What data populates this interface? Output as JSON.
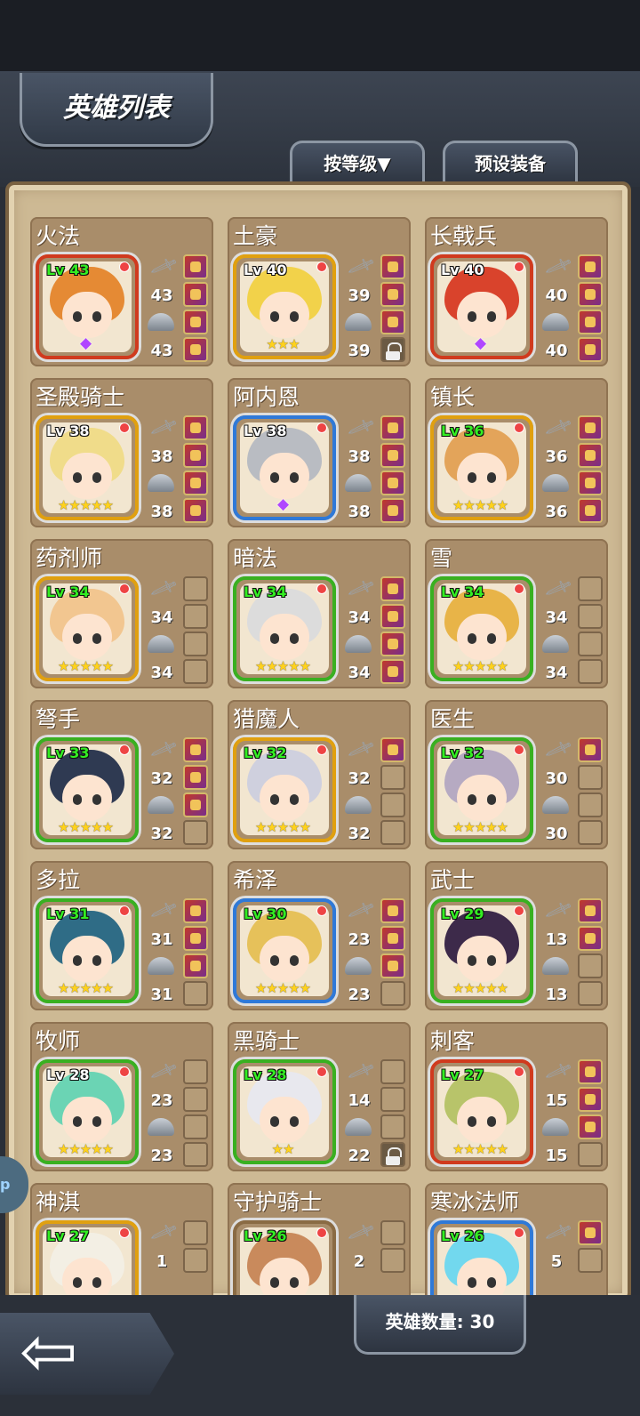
{
  "header": {
    "title": "英雄列表",
    "sort_button": "按等级▼",
    "preset_button": "预设装备"
  },
  "footer": {
    "hero_count": "英雄数量: 30"
  },
  "side_tab": {
    "text": "p"
  },
  "colors": {
    "red": "#d03a1e",
    "gold": "#e0a010",
    "blue": "#2f79d8",
    "green": "#39b021"
  },
  "heroes": [
    {
      "name": "火法",
      "level": "Lv 43",
      "atk": "43",
      "def": "43",
      "frame": "#d03a1e",
      "hair": "#e58a34",
      "stars": "",
      "gem": "◆",
      "slots": [
        "filled",
        "filled",
        "filled",
        "filled"
      ],
      "white_lv": false
    },
    {
      "name": "土豪",
      "level": "Lv 40",
      "atk": "39",
      "def": "39",
      "frame": "#e0a010",
      "hair": "#f2d24a",
      "stars": "★★★",
      "gem": "",
      "slots": [
        "filled",
        "filled",
        "filled",
        "lock"
      ],
      "white_lv": true
    },
    {
      "name": "长戟兵",
      "level": "Lv 40",
      "atk": "40",
      "def": "40",
      "frame": "#d03a1e",
      "hair": "#d9432c",
      "stars": "",
      "gem": "◆",
      "slots": [
        "filled",
        "filled",
        "filled",
        "filled"
      ],
      "white_lv": true
    },
    {
      "name": "圣殿骑士",
      "level": "Lv 38",
      "atk": "38",
      "def": "38",
      "frame": "#e0a010",
      "hair": "#f0dc8a",
      "stars": "★★★★★",
      "gem": "",
      "slots": [
        "filled",
        "filled",
        "filled",
        "filled"
      ],
      "white_lv": true
    },
    {
      "name": "阿内恩",
      "level": "Lv 38",
      "atk": "38",
      "def": "38",
      "frame": "#2f79d8",
      "hair": "#b9bcc2",
      "stars": "",
      "gem": "◆",
      "slots": [
        "filled",
        "filled",
        "filled",
        "filled"
      ],
      "white_lv": true
    },
    {
      "name": "镇长",
      "level": "Lv 36",
      "atk": "36",
      "def": "36",
      "frame": "#e0a010",
      "hair": "#e3a45a",
      "stars": "★★★★★",
      "gem": "",
      "slots": [
        "filled",
        "filled",
        "filled",
        "filled"
      ],
      "white_lv": false
    },
    {
      "name": "药剂师",
      "level": "Lv 34",
      "atk": "34",
      "def": "34",
      "frame": "#e0a010",
      "hair": "#f2c690",
      "stars": "★★★★★",
      "gem": "",
      "slots": [
        "",
        "",
        "",
        ""
      ],
      "white_lv": false
    },
    {
      "name": "暗法",
      "level": "Lv 34",
      "atk": "34",
      "def": "34",
      "frame": "#39b021",
      "hair": "#dcdcdc",
      "stars": "★★★★★",
      "gem": "",
      "slots": [
        "filled",
        "filled",
        "filled",
        "filled"
      ],
      "white_lv": false
    },
    {
      "name": "雪",
      "level": "Lv 34",
      "atk": "34",
      "def": "34",
      "frame": "#39b021",
      "hair": "#e8b448",
      "stars": "★★★★★",
      "gem": "",
      "slots": [
        "",
        "",
        "",
        ""
      ],
      "white_lv": false
    },
    {
      "name": "弩手",
      "level": "Lv 33",
      "atk": "32",
      "def": "32",
      "frame": "#39b021",
      "hair": "#2f3a52",
      "stars": "★★★★★",
      "gem": "",
      "slots": [
        "filled",
        "filled",
        "filled",
        ""
      ],
      "white_lv": false
    },
    {
      "name": "猎魔人",
      "level": "Lv 32",
      "atk": "32",
      "def": "32",
      "frame": "#e0a010",
      "hair": "#cfd0de",
      "stars": "★★★★★",
      "gem": "",
      "slots": [
        "filled",
        "",
        "",
        ""
      ],
      "white_lv": false
    },
    {
      "name": "医生",
      "level": "Lv 32",
      "atk": "30",
      "def": "30",
      "frame": "#39b021",
      "hair": "#b6aac2",
      "stars": "★★★★★",
      "gem": "",
      "slots": [
        "filled",
        "",
        "",
        ""
      ],
      "white_lv": false
    },
    {
      "name": "多拉",
      "level": "Lv 31",
      "atk": "31",
      "def": "31",
      "frame": "#39b021",
      "hair": "#2f6c86",
      "stars": "★★★★★",
      "gem": "",
      "slots": [
        "filled",
        "filled",
        "filled",
        ""
      ],
      "white_lv": false
    },
    {
      "name": "希泽",
      "level": "Lv 30",
      "atk": "23",
      "def": "23",
      "frame": "#2f79d8",
      "hair": "#e6c15a",
      "stars": "★★★★★",
      "gem": "",
      "slots": [
        "filled",
        "filled",
        "filled",
        ""
      ],
      "white_lv": false
    },
    {
      "name": "武士",
      "level": "Lv 29",
      "atk": "13",
      "def": "13",
      "frame": "#39b021",
      "hair": "#3d2a4a",
      "stars": "★★★★★",
      "gem": "",
      "slots": [
        "filled",
        "filled",
        "",
        ""
      ],
      "white_lv": false
    },
    {
      "name": "牧师",
      "level": "Lv 28",
      "atk": "23",
      "def": "23",
      "frame": "#39b021",
      "hair": "#6bd4b4",
      "stars": "★★★★★",
      "gem": "",
      "slots": [
        "",
        "",
        "",
        ""
      ],
      "white_lv": true
    },
    {
      "name": "黑骑士",
      "level": "Lv 28",
      "atk": "14",
      "def": "22",
      "frame": "#39b021",
      "hair": "#e8e8ee",
      "stars": "★★",
      "gem": "",
      "slots": [
        "",
        "",
        "",
        "lock"
      ],
      "white_lv": false
    },
    {
      "name": "刺客",
      "level": "Lv 27",
      "atk": "15",
      "def": "15",
      "frame": "#d03a1e",
      "hair": "#b8c46a",
      "stars": "★★★★★",
      "gem": "",
      "slots": [
        "filled",
        "filled",
        "filled",
        ""
      ],
      "white_lv": false
    },
    {
      "name": "神淇",
      "level": "Lv 27",
      "atk": "1",
      "def": "",
      "frame": "#e0a010",
      "hair": "#f3efe4",
      "stars": "",
      "gem": "",
      "slots": [
        "",
        ""
      ],
      "white_lv": false
    },
    {
      "name": "守护骑士",
      "level": "Lv 26",
      "atk": "2",
      "def": "",
      "frame": "#8a6b44",
      "hair": "#c98a5c",
      "stars": "",
      "gem": "",
      "slots": [
        "",
        ""
      ],
      "white_lv": false
    },
    {
      "name": "寒冰法师",
      "level": "Lv 26",
      "atk": "5",
      "def": "",
      "frame": "#2f79d8",
      "hair": "#72d8ee",
      "stars": "",
      "gem": "",
      "slots": [
        "filled",
        ""
      ],
      "white_lv": false
    }
  ]
}
